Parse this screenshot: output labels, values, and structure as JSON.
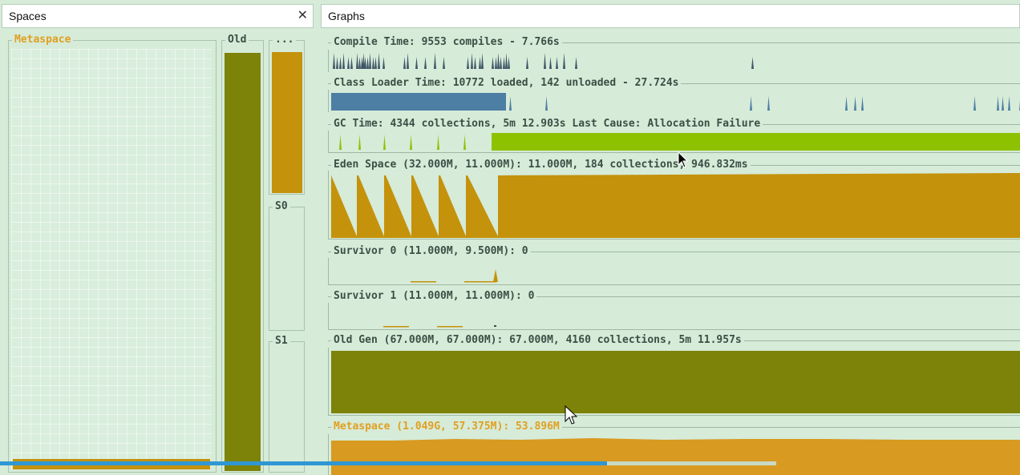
{
  "spaces_tab": {
    "title": "Spaces",
    "close_glyph": "✕"
  },
  "graphs_tab": {
    "title": "Graphs"
  },
  "spaces": {
    "metaspace_label": "Metaspace",
    "old_label": "Old",
    "eden_label": "...",
    "s0_label": "S0",
    "s1_label": "S1"
  },
  "graphs": {
    "compile_time": "Compile Time: 9553 compiles - 7.766s",
    "class_loader_time": "Class Loader Time: 10772 loaded, 142 unloaded - 27.724s",
    "gc_time": "GC Time: 4344 collections, 5m 12.903s  Last Cause: Allocation Failure",
    "eden_space": "Eden Space (32.000M, 11.000M): 11.000M, 184 collections, 946.832ms",
    "survivor0": "Survivor 0 (11.000M, 9.500M): 0",
    "survivor1": "Survivor 1 (11.000M, 11.000M): 0",
    "old_gen": "Old Gen (67.000M, 67.000M): 67.000M, 4160 collections, 5m 11.957s",
    "metaspace": "Metaspace (1.049G, 57.375M): 53.896M"
  },
  "video_progress": {
    "played_fraction": 0.595,
    "buffered_fraction": 0.761
  },
  "colors": {
    "background": "#d6ebd8",
    "compile": "#3f5566",
    "class_loader": "#4d7ea3",
    "gc": "#8dc200",
    "eden": "#c4920b",
    "old": "#7d8208",
    "metaspace": "#d89a20",
    "progress": "#2f97d4"
  }
}
